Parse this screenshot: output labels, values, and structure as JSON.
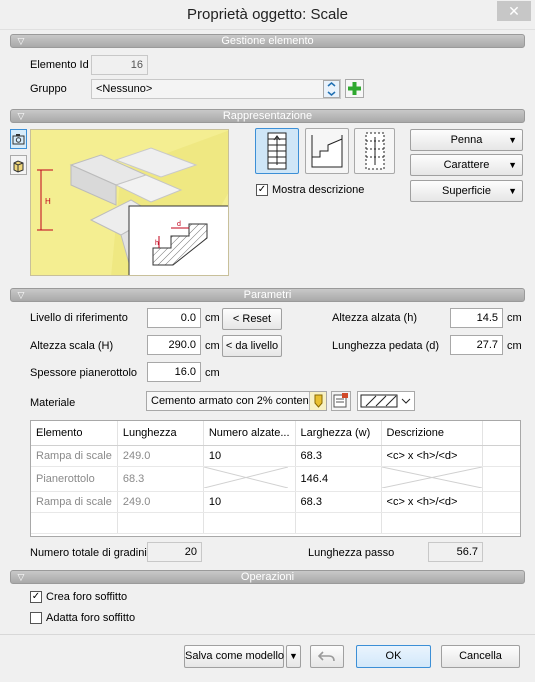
{
  "window": {
    "title": "Proprietà oggetto: Scale",
    "close_label": "✕"
  },
  "sections": {
    "gestione": "Gestione elemento",
    "rappresentazione": "Rappresentazione",
    "parametri": "Parametri",
    "operazioni": "Operazioni"
  },
  "gestione": {
    "elemento_id_label": "Elemento Id",
    "elemento_id_value": "16",
    "gruppo_label": "Gruppo",
    "gruppo_value": "<Nessuno>"
  },
  "rappresentazione": {
    "preview_labels": {
      "h": "H",
      "small_h": "h",
      "small_d": "d"
    },
    "mostra_descrizione_label": "Mostra descrizione",
    "mostra_descrizione_checked": true,
    "penna_label": "Penna",
    "carattere_label": "Carattere",
    "superficie_label": "Superficie"
  },
  "parametri": {
    "livello_label": "Livello di riferimento",
    "livello_value": "0.0",
    "altezza_scala_label": "Altezza scala (H)",
    "altezza_scala_value": "290.0",
    "spessore_label": "Spessore pianerottolo",
    "spessore_value": "16.0",
    "unit": "cm",
    "reset_label": "< Reset",
    "da_livello_label": "< da livello",
    "altezza_alzata_label": "Altezza alzata (h)",
    "altezza_alzata_value": "14.5",
    "lunghezza_pedata_label": "Lunghezza pedata (d)",
    "lunghezza_pedata_value": "27.7",
    "materiale_label": "Materiale",
    "materiale_value": "Cemento armato con 2% contene",
    "table": {
      "headers": [
        "Elemento",
        "Lunghezza",
        "Numero alzate...",
        "Larghezza (w)",
        "Descrizione"
      ],
      "rows": [
        [
          "Rampa di scale",
          "249.0",
          "10",
          "68.3",
          "<c> x <h>/<d>"
        ],
        [
          "Pianerottolo",
          "68.3",
          "",
          "146.4",
          ""
        ],
        [
          "Rampa di scale",
          "249.0",
          "10",
          "68.3",
          "<c> x <h>/<d>"
        ]
      ]
    },
    "numero_gradini_label": "Numero totale di gradini",
    "numero_gradini_value": "20",
    "lunghezza_passo_label": "Lunghezza passo",
    "lunghezza_passo_value": "56.7"
  },
  "operazioni": {
    "crea_foro_label": "Crea foro soffitto",
    "crea_foro_checked": true,
    "adatta_foro_label": "Adatta foro soffitto",
    "adatta_foro_checked": false
  },
  "footer": {
    "salva_modello_label": "Salva come modello",
    "ok_label": "OK",
    "cancella_label": "Cancella"
  },
  "colors": {
    "section_bar": "#b5b5b5",
    "preview_bg": "#f2ec8a",
    "plus_green": "#2fa82f",
    "dimension_red": "#c0001a",
    "selected_button": "#cfe6f7"
  }
}
